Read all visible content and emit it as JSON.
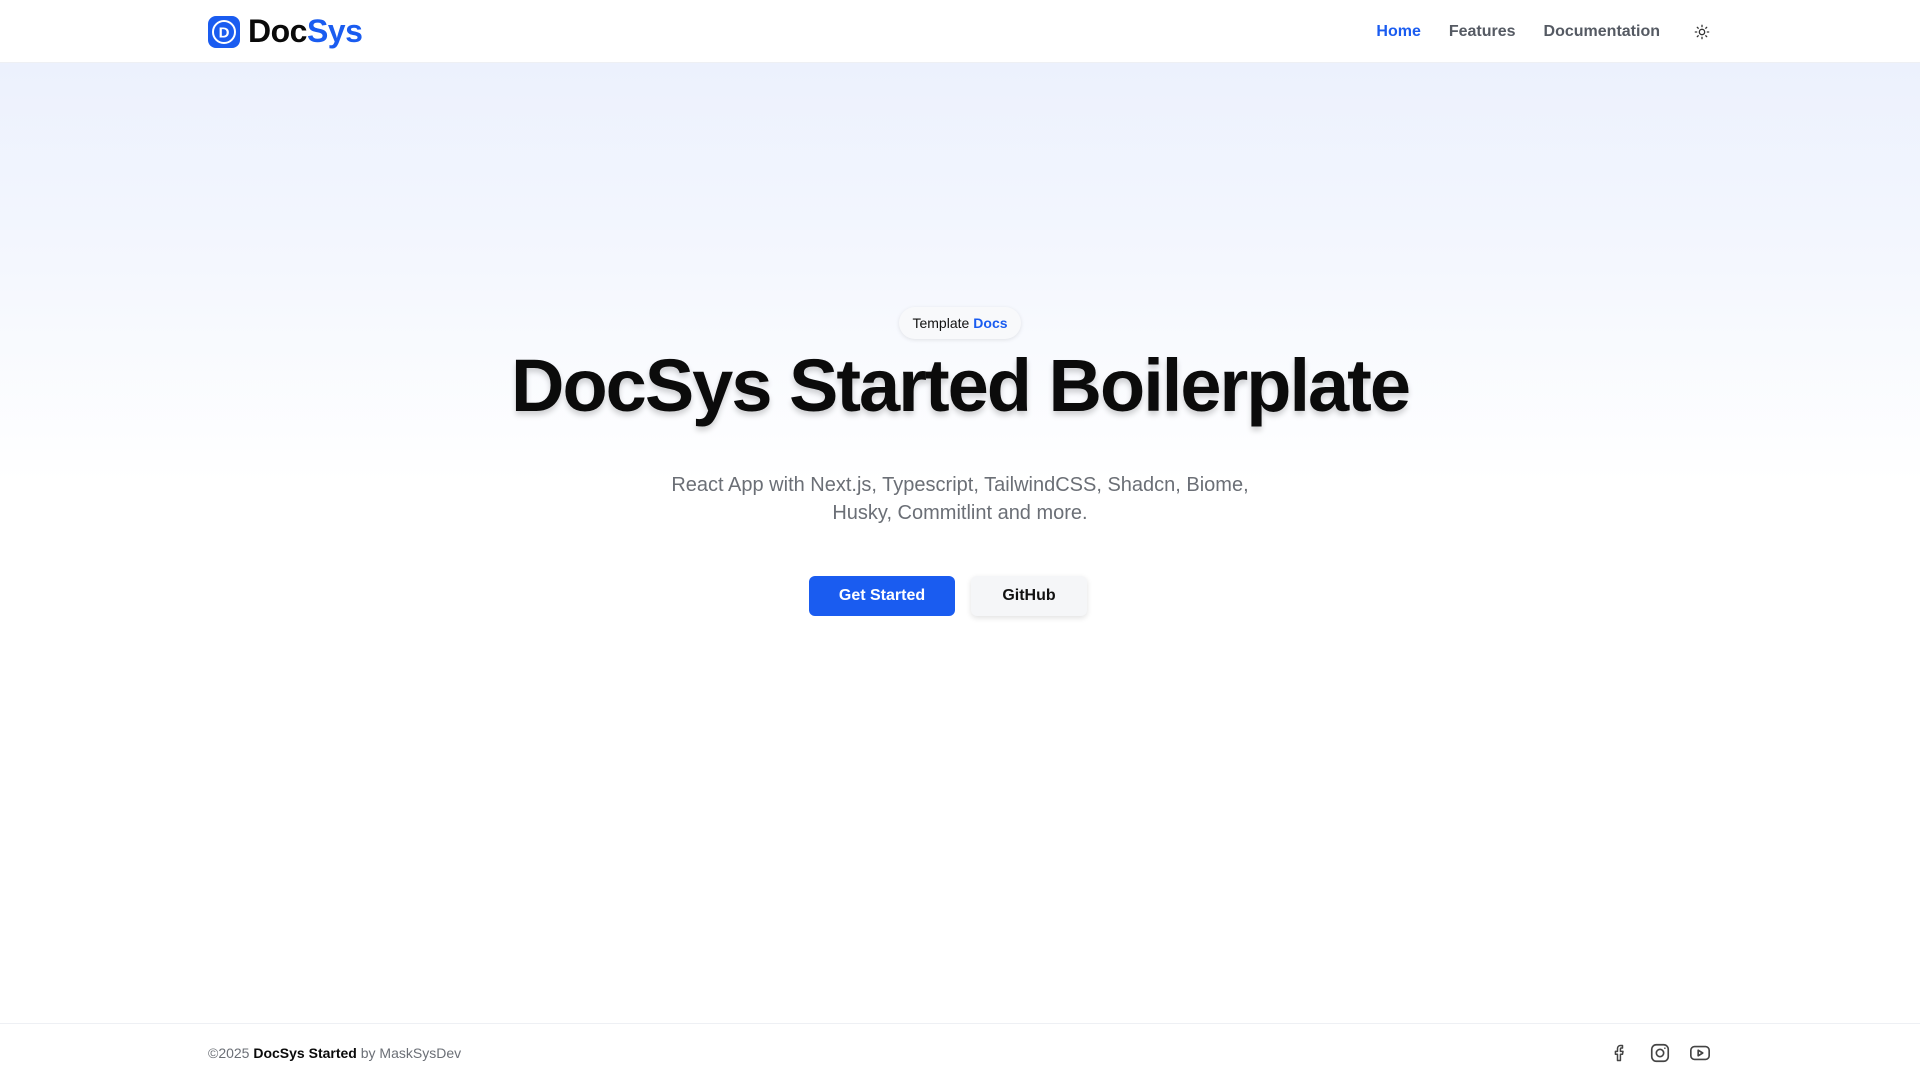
{
  "header": {
    "brand": {
      "logo_letter": "D",
      "name_part1": "Doc",
      "name_part2": "Sys",
      "accent_color": "#1a5cf0"
    },
    "nav": [
      {
        "label": "Home",
        "active": true
      },
      {
        "label": "Features",
        "active": false
      },
      {
        "label": "Documentation",
        "active": false
      }
    ],
    "theme_toggle_icon": "sun-icon"
  },
  "hero": {
    "badge": {
      "text": "Template",
      "accent": "Docs"
    },
    "title": "DocSys Started Boilerplate",
    "subtitle": "React App with Next.js, Typescript, TailwindCSS, Shadcn, Biome, Husky, Commitlint and more.",
    "primary_button": "Get Started",
    "secondary_button": "GitHub"
  },
  "footer": {
    "copyright_prefix": "©2025",
    "project_name": "DocSys Started",
    "by_text": "by",
    "author": "MaskSysDev",
    "socials": [
      "facebook-icon",
      "instagram-icon",
      "youtube-icon"
    ]
  }
}
